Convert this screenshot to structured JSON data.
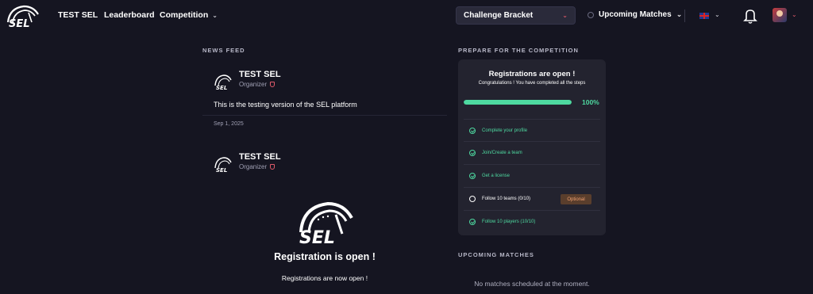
{
  "brand": {
    "logo_text": "SEL"
  },
  "nav": {
    "items": [
      {
        "label": "TEST SEL"
      },
      {
        "label": "Leaderboard"
      },
      {
        "label": "Competition"
      }
    ],
    "bracket_select": "Challenge Bracket",
    "upcoming_toggle": "Upcoming Matches",
    "language_flag": "uk-flag-icon",
    "notifications_icon": "bell-icon"
  },
  "news_feed": {
    "title": "NEWS FEED",
    "posts": [
      {
        "author": "TEST SEL",
        "role": "Organizer",
        "text": "This is the testing version of the SEL platform",
        "date": "Sep 1, 2025"
      },
      {
        "author": "TEST SEL",
        "role": "Organizer",
        "headline": "Registration is open !",
        "body": "Registrations are now open !"
      }
    ]
  },
  "prepare": {
    "title": "PREPARE FOR THE COMPETITION",
    "card_title": "Registrations are open !",
    "card_subtitle": "Congratulations ! You have completed all the steps",
    "progress_percent": 100,
    "progress_label": "100%",
    "steps": [
      {
        "label": "Complete your profile",
        "done": true
      },
      {
        "label": "Join/Create a team",
        "done": true
      },
      {
        "label": "Get a license",
        "done": true
      },
      {
        "label": "Follow 10 teams (0/10)",
        "done": false,
        "badge": "Optional"
      },
      {
        "label": "Follow 10 players (10/10)",
        "done": true
      }
    ]
  },
  "upcoming_matches": {
    "title": "UPCOMING MATCHES",
    "empty_text": "No matches scheduled at the moment."
  },
  "colors": {
    "background": "#151521",
    "card": "#23232f",
    "accent_green": "#4ed9a0",
    "accent_red": "#e05a6a"
  }
}
